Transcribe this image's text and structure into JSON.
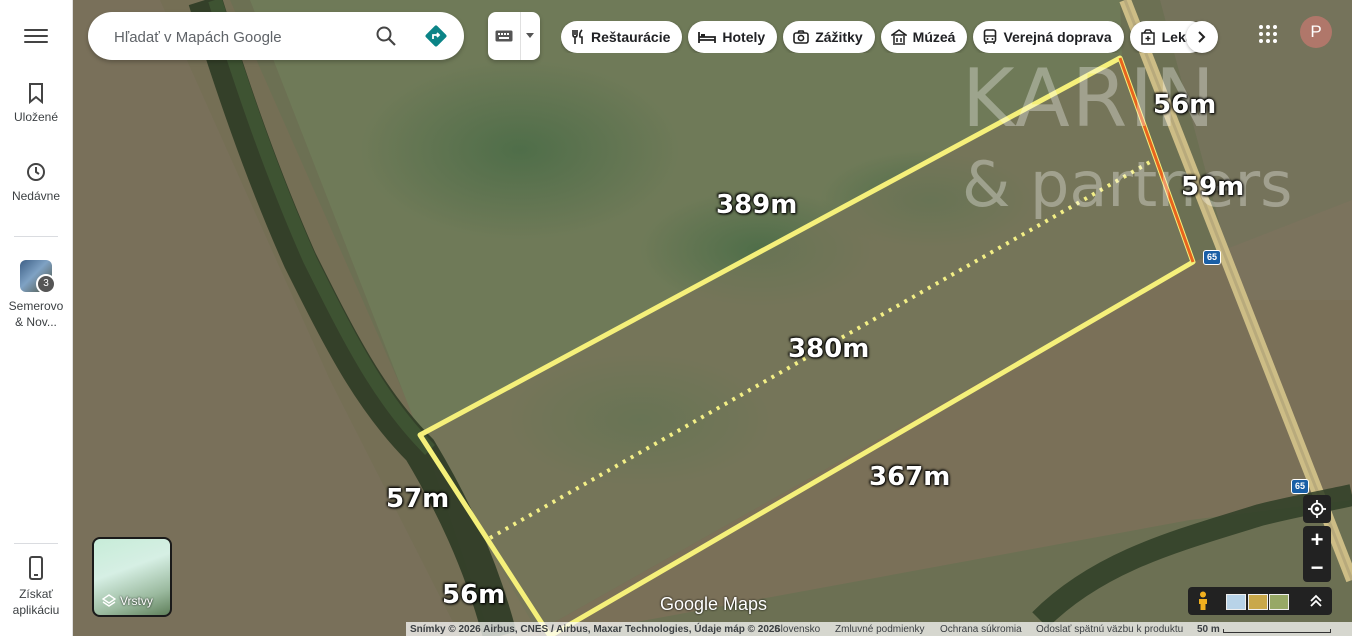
{
  "sidebar": {
    "saved_label": "Uložené",
    "recent_label": "Nedávne",
    "recent_place_label": "Semerovo & Nov...",
    "recent_place_count": "3",
    "get_app_label": "Získať aplikáciu"
  },
  "search": {
    "placeholder": "Hľadať v Mapách Google"
  },
  "chips": [
    {
      "label": "Reštaurácie",
      "icon": "fork-knife-icon"
    },
    {
      "label": "Hotely",
      "icon": "bed-icon"
    },
    {
      "label": "Zážitky",
      "icon": "camera-icon"
    },
    {
      "label": "Múzeá",
      "icon": "museum-icon"
    },
    {
      "label": "Verejná doprava",
      "icon": "bus-icon"
    },
    {
      "label": "Leká",
      "icon": "pharmacy-icon"
    }
  ],
  "account": {
    "avatar_letter": "P"
  },
  "measurements": {
    "top": "389m",
    "middle": "380m",
    "bottom": "367m",
    "left_upper": "57m",
    "left_lower": "56m",
    "right_upper": "56m",
    "right_lower": "59m"
  },
  "watermark": {
    "line1": "KARIN",
    "line2": "& partners"
  },
  "road_shield": "65",
  "map_logo": "Google Maps",
  "layers": {
    "label": "Vrstvy"
  },
  "footer": {
    "attribution": "Snímky © 2026 Airbus, CNES / Airbus, Maxar Technologies, Údaje máp © 2026",
    "country": "Slovensko",
    "terms": "Zmluvné podmienky",
    "privacy": "Ochrana súkromia",
    "feedback": "Odoslať spätnú väzbu k produktu",
    "scale": "50 m"
  },
  "colors": {
    "outline": "#f5f07a",
    "dotted": "#f3ef86",
    "right_edge": "#e8641e",
    "sidebar_bg": "#ffffff",
    "avatar_bg": "#b0776a"
  }
}
